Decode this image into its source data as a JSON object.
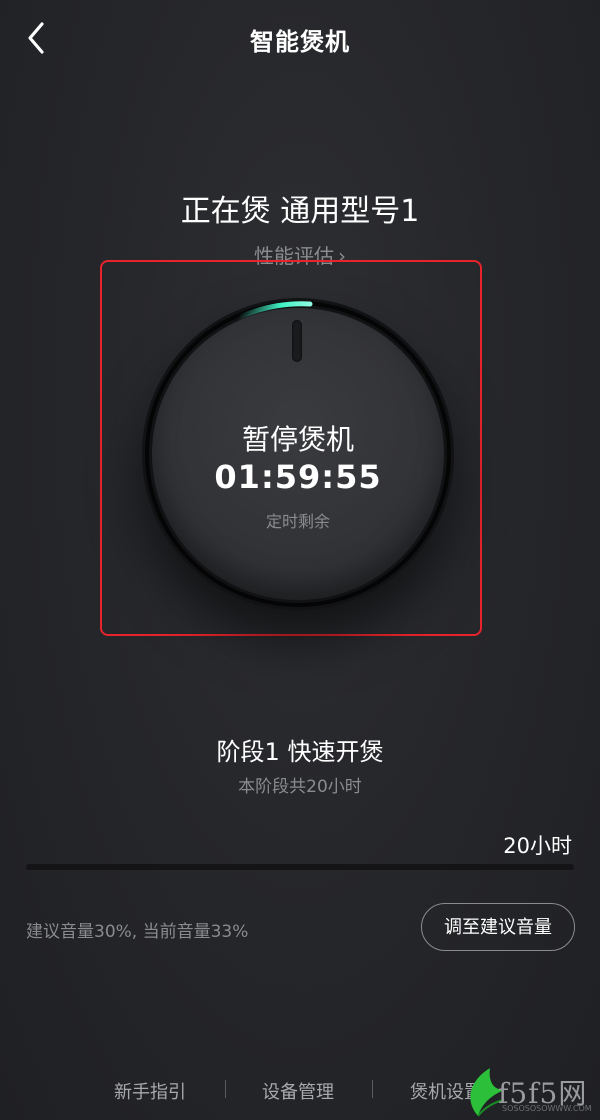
{
  "header": {
    "title": "智能煲机"
  },
  "status": {
    "title": "正在煲 通用型号1",
    "perf_link": "性能评估",
    "perf_chevron": "›"
  },
  "dial": {
    "action": "暂停煲机",
    "time": "01:59:55",
    "caption": "定时剩余",
    "accent": "#3ff0c4"
  },
  "stage": {
    "title": "阶段1 快速开煲",
    "subtitle": "本阶段共20小时"
  },
  "progress": {
    "value_label": "20小时",
    "fraction": 1.0
  },
  "volume": {
    "text": "建议音量30%, 当前音量33%",
    "button_label": "调至建议音量"
  },
  "bottom_nav": {
    "items": [
      "新手指引",
      "设备管理",
      "煲机设置"
    ]
  },
  "watermark": {
    "text": "f5f5网",
    "small": "SOSOSOSOWWW.COM"
  },
  "colors": {
    "background": "#26272b",
    "highlight": "#e8232b",
    "muted_text": "#8a8b8f"
  }
}
